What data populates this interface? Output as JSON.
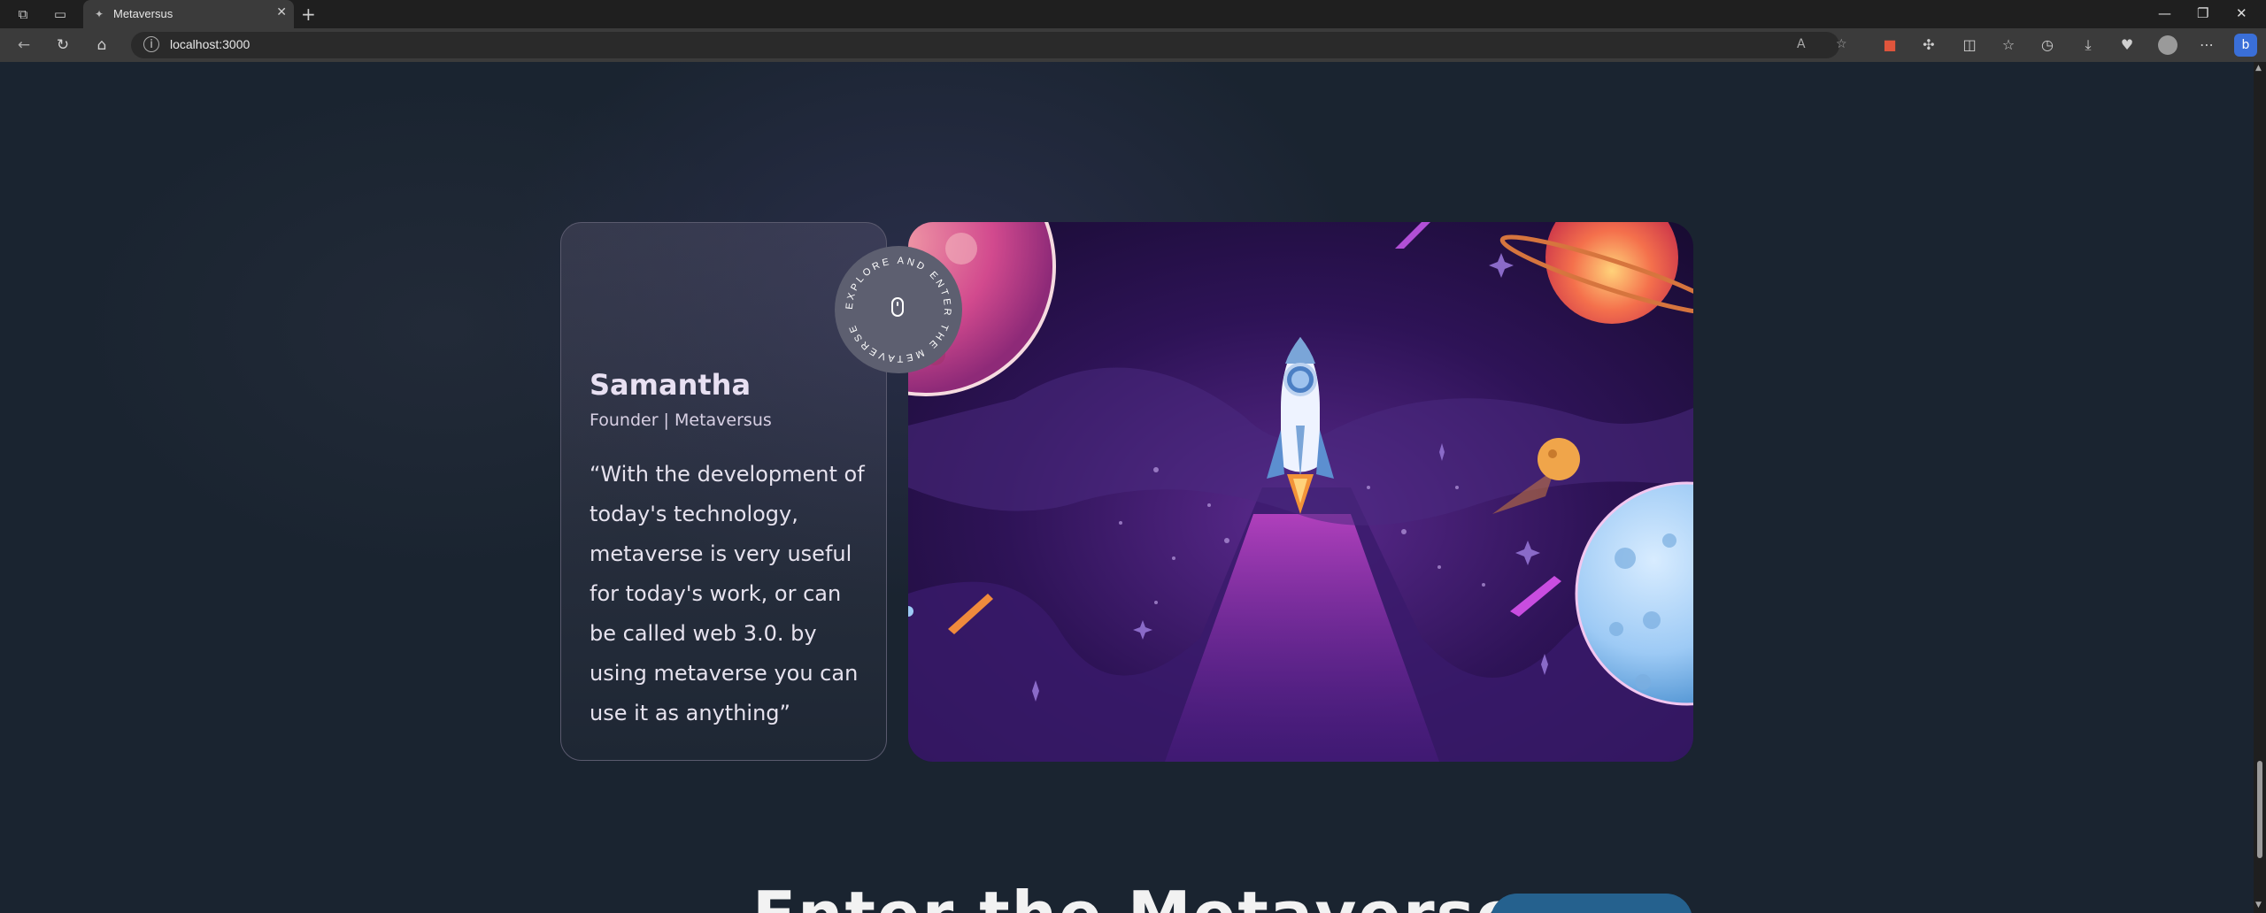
{
  "browser": {
    "tab_title": "Metaversus",
    "url": "localhost:3000"
  },
  "testimonial": {
    "name": "Samantha",
    "role": "Founder | Metaversus",
    "quote": "“With the development of today's technology, metaverse is very useful for today's work, or can be called web 3.0. by using metaverse you can use it as anything”"
  },
  "explore_badge": {
    "circular_text": "EXPLORE AND ENTER THE METAVERSE"
  },
  "next_section": {
    "heading": "Enter the Metaverse"
  },
  "colors": {
    "page_bg": "#1a2430",
    "card_border": "#5a5a6e",
    "badge_bg": "#5d5f70",
    "button_blue": "#25618e"
  }
}
